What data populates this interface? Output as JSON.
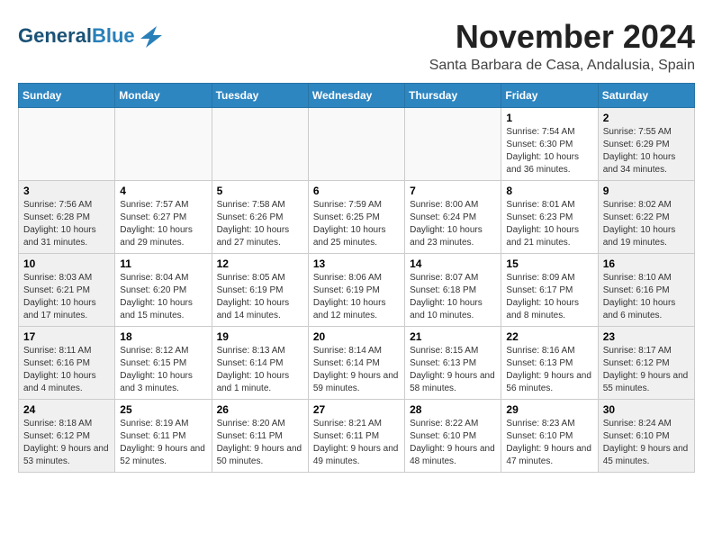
{
  "header": {
    "logo_line1": "General",
    "logo_line2": "Blue",
    "month_year": "November 2024",
    "location": "Santa Barbara de Casa, Andalusia, Spain"
  },
  "weekdays": [
    "Sunday",
    "Monday",
    "Tuesday",
    "Wednesday",
    "Thursday",
    "Friday",
    "Saturday"
  ],
  "weeks": [
    [
      {
        "day": "",
        "info": ""
      },
      {
        "day": "",
        "info": ""
      },
      {
        "day": "",
        "info": ""
      },
      {
        "day": "",
        "info": ""
      },
      {
        "day": "",
        "info": ""
      },
      {
        "day": "1",
        "info": "Sunrise: 7:54 AM\nSunset: 6:30 PM\nDaylight: 10 hours and 36 minutes."
      },
      {
        "day": "2",
        "info": "Sunrise: 7:55 AM\nSunset: 6:29 PM\nDaylight: 10 hours and 34 minutes."
      }
    ],
    [
      {
        "day": "3",
        "info": "Sunrise: 7:56 AM\nSunset: 6:28 PM\nDaylight: 10 hours and 31 minutes."
      },
      {
        "day": "4",
        "info": "Sunrise: 7:57 AM\nSunset: 6:27 PM\nDaylight: 10 hours and 29 minutes."
      },
      {
        "day": "5",
        "info": "Sunrise: 7:58 AM\nSunset: 6:26 PM\nDaylight: 10 hours and 27 minutes."
      },
      {
        "day": "6",
        "info": "Sunrise: 7:59 AM\nSunset: 6:25 PM\nDaylight: 10 hours and 25 minutes."
      },
      {
        "day": "7",
        "info": "Sunrise: 8:00 AM\nSunset: 6:24 PM\nDaylight: 10 hours and 23 minutes."
      },
      {
        "day": "8",
        "info": "Sunrise: 8:01 AM\nSunset: 6:23 PM\nDaylight: 10 hours and 21 minutes."
      },
      {
        "day": "9",
        "info": "Sunrise: 8:02 AM\nSunset: 6:22 PM\nDaylight: 10 hours and 19 minutes."
      }
    ],
    [
      {
        "day": "10",
        "info": "Sunrise: 8:03 AM\nSunset: 6:21 PM\nDaylight: 10 hours and 17 minutes."
      },
      {
        "day": "11",
        "info": "Sunrise: 8:04 AM\nSunset: 6:20 PM\nDaylight: 10 hours and 15 minutes."
      },
      {
        "day": "12",
        "info": "Sunrise: 8:05 AM\nSunset: 6:19 PM\nDaylight: 10 hours and 14 minutes."
      },
      {
        "day": "13",
        "info": "Sunrise: 8:06 AM\nSunset: 6:19 PM\nDaylight: 10 hours and 12 minutes."
      },
      {
        "day": "14",
        "info": "Sunrise: 8:07 AM\nSunset: 6:18 PM\nDaylight: 10 hours and 10 minutes."
      },
      {
        "day": "15",
        "info": "Sunrise: 8:09 AM\nSunset: 6:17 PM\nDaylight: 10 hours and 8 minutes."
      },
      {
        "day": "16",
        "info": "Sunrise: 8:10 AM\nSunset: 6:16 PM\nDaylight: 10 hours and 6 minutes."
      }
    ],
    [
      {
        "day": "17",
        "info": "Sunrise: 8:11 AM\nSunset: 6:16 PM\nDaylight: 10 hours and 4 minutes."
      },
      {
        "day": "18",
        "info": "Sunrise: 8:12 AM\nSunset: 6:15 PM\nDaylight: 10 hours and 3 minutes."
      },
      {
        "day": "19",
        "info": "Sunrise: 8:13 AM\nSunset: 6:14 PM\nDaylight: 10 hours and 1 minute."
      },
      {
        "day": "20",
        "info": "Sunrise: 8:14 AM\nSunset: 6:14 PM\nDaylight: 9 hours and 59 minutes."
      },
      {
        "day": "21",
        "info": "Sunrise: 8:15 AM\nSunset: 6:13 PM\nDaylight: 9 hours and 58 minutes."
      },
      {
        "day": "22",
        "info": "Sunrise: 8:16 AM\nSunset: 6:13 PM\nDaylight: 9 hours and 56 minutes."
      },
      {
        "day": "23",
        "info": "Sunrise: 8:17 AM\nSunset: 6:12 PM\nDaylight: 9 hours and 55 minutes."
      }
    ],
    [
      {
        "day": "24",
        "info": "Sunrise: 8:18 AM\nSunset: 6:12 PM\nDaylight: 9 hours and 53 minutes."
      },
      {
        "day": "25",
        "info": "Sunrise: 8:19 AM\nSunset: 6:11 PM\nDaylight: 9 hours and 52 minutes."
      },
      {
        "day": "26",
        "info": "Sunrise: 8:20 AM\nSunset: 6:11 PM\nDaylight: 9 hours and 50 minutes."
      },
      {
        "day": "27",
        "info": "Sunrise: 8:21 AM\nSunset: 6:11 PM\nDaylight: 9 hours and 49 minutes."
      },
      {
        "day": "28",
        "info": "Sunrise: 8:22 AM\nSunset: 6:10 PM\nDaylight: 9 hours and 48 minutes."
      },
      {
        "day": "29",
        "info": "Sunrise: 8:23 AM\nSunset: 6:10 PM\nDaylight: 9 hours and 47 minutes."
      },
      {
        "day": "30",
        "info": "Sunrise: 8:24 AM\nSunset: 6:10 PM\nDaylight: 9 hours and 45 minutes."
      }
    ]
  ]
}
